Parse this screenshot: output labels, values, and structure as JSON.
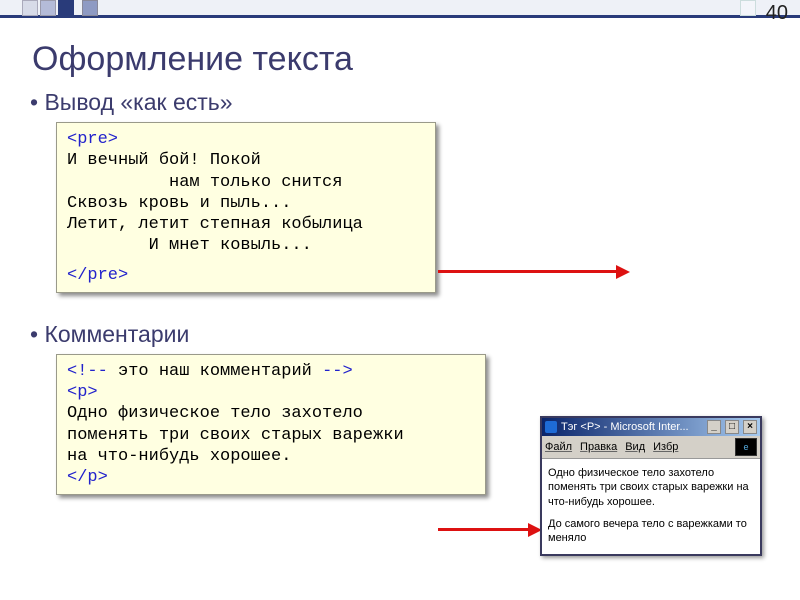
{
  "page_number": "40",
  "title": "Оформление текста",
  "bullets": {
    "preformatted": "Вывод «как есть»",
    "comments": "Комментарии"
  },
  "code_pre": {
    "open_tag": "<pre>",
    "line1": "И вечный бой! Покой",
    "line2": "          нам только снится",
    "line3": "Сквозь кровь и пыль...",
    "line4": "Летит, летит степная кобылица",
    "line5": "        И мнет ковыль...",
    "close_tag": "</pre>"
  },
  "code_comment": {
    "comment_open": "<!--",
    "comment_text": " это наш комментарий ",
    "comment_close": "-->",
    "open_tag": "<p>",
    "line1": "Одно физическое тело захотело",
    "line2": "поменять три своих старых варежки",
    "line3": "на что-нибудь хорошее.",
    "close_tag": "</p>"
  },
  "browser": {
    "title": "Тэг <Р> - Microsoft Inter...",
    "minimize": "_",
    "maximize": "□",
    "close": "×",
    "menu": {
      "file": "Файл",
      "edit": "Правка",
      "view": "Вид",
      "favorites": "Избр"
    },
    "content": {
      "p1": "Одно физическое тело захотело поменять три своих старых варежки на что-нибудь хорошее.",
      "p2": "До самого вечера тело с варежками то меняло"
    }
  },
  "colors": {
    "accent": "#293b7a",
    "code_keyword": "#2222cc",
    "code_bg": "#ffffe1",
    "arrow": "#d11"
  }
}
